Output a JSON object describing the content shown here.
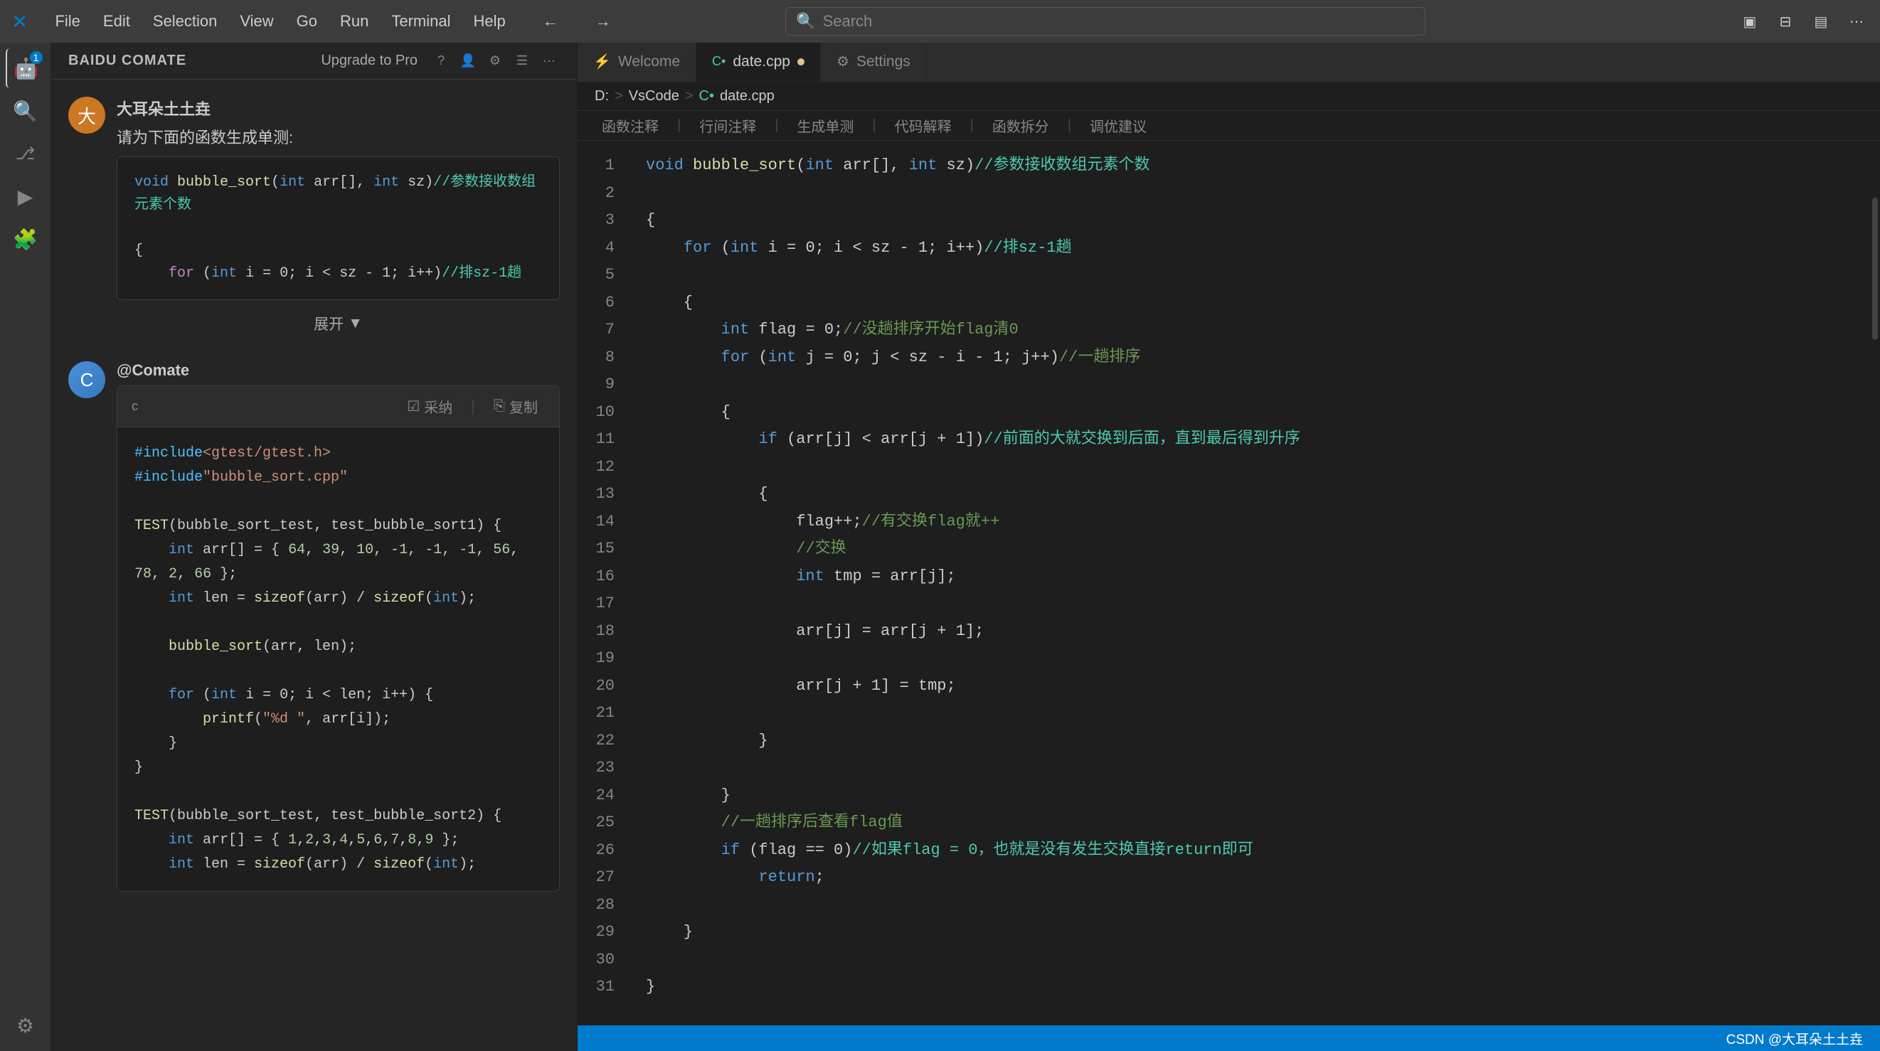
{
  "titlebar": {
    "menus": [
      "File",
      "Edit",
      "Selection",
      "View",
      "Go",
      "Run",
      "Terminal",
      "Help"
    ],
    "search_placeholder": "Search",
    "nav_back": "←",
    "nav_forward": "→"
  },
  "activity_bar": {
    "items": [
      {
        "icon": "🤖",
        "label": "comate-icon",
        "badge": "1",
        "active": true
      },
      {
        "icon": "🔍",
        "label": "search-icon"
      },
      {
        "icon": "⎇",
        "label": "source-control-icon"
      },
      {
        "icon": "▶",
        "label": "run-icon"
      },
      {
        "icon": "🧩",
        "label": "extensions-icon"
      }
    ],
    "bottom_items": [
      {
        "icon": "⚙",
        "label": "settings-icon"
      }
    ]
  },
  "sidebar": {
    "title": "BAIDU COMATE",
    "upgrade_label": "Upgrade to Pro",
    "actions": [
      "?",
      "👤",
      "⚙",
      "☰",
      "···"
    ]
  },
  "chat": {
    "user": {
      "name": "大耳朵土土垚",
      "avatar_text": "大",
      "prompt": "请为下面的函数生成单测:"
    },
    "code_preview": {
      "line1": "void bubble_sort(int arr[], int sz)//参数接收数组元素个数",
      "line2": "{",
      "line3": "    for (int i = 0; i < sz - 1; i++)//排sz-1趟",
      "expand_label": "展开",
      "expand_icon": "▼"
    },
    "comate": {
      "name": "@Comate",
      "avatar_text": "C",
      "lang": "c",
      "adopt_label": "采纳",
      "copy_label": "复制",
      "code_lines": [
        "#include<gtest/gtest.h>",
        "#include\"bubble_sort.cpp\"",
        "",
        "TEST(bubble_sort_test, test_bubble_sort1) {",
        "    int arr[] = { 64, 39, 10, -1, -1, -1, 56, 78, 2, 66 };",
        "    int len = sizeof(arr) / sizeof(int);",
        "",
        "    bubble_sort(arr, len);",
        "",
        "    for (int i = 0; i < len; i++) {",
        "        printf(\"%d \", arr[i]);",
        "    }",
        "}",
        "",
        "TEST(bubble_sort_test, test_bubble_sort2) {",
        "    int arr[] = { 1,2,3,4,5,6,7,8,9 };",
        "    int len = sizeof(arr) / sizeof(int);"
      ]
    }
  },
  "tabs": [
    {
      "label": "Welcome",
      "icon": "⚡",
      "active": false
    },
    {
      "label": "date.cpp",
      "icon": "C•",
      "active": true,
      "modified": true
    },
    {
      "label": "Settings",
      "icon": "⚙",
      "active": false
    }
  ],
  "breadcrumb": {
    "parts": [
      "D:",
      "VsCode",
      "C•",
      "date.cpp"
    ]
  },
  "toolbar": {
    "items": [
      "函数注释",
      "|",
      "行间注释",
      "|",
      "生成单测",
      "|",
      "代码解释",
      "|",
      "函数拆分",
      "|",
      "调优建议"
    ]
  },
  "editor": {
    "lines": [
      {
        "num": 1,
        "text": "void bubble_sort(int arr[], int sz)//参数接收数组元素个数"
      },
      {
        "num": 2,
        "text": ""
      },
      {
        "num": 3,
        "text": "{"
      },
      {
        "num": 4,
        "text": "    for (int i = 0; i < sz - 1; i++)//排sz-1趟"
      },
      {
        "num": 5,
        "text": ""
      },
      {
        "num": 6,
        "text": "    {"
      },
      {
        "num": 7,
        "text": "        int flag = 0;//没趟排序开始flag清0"
      },
      {
        "num": 8,
        "text": "        for (int j = 0; j < sz - i - 1; j++)//一趟排序"
      },
      {
        "num": 9,
        "text": ""
      },
      {
        "num": 10,
        "text": "        {"
      },
      {
        "num": 11,
        "text": "            if (arr[j] < arr[j + 1])//前面的大就交换到后面，直到最后得到升序"
      },
      {
        "num": 12,
        "text": ""
      },
      {
        "num": 13,
        "text": "            {"
      },
      {
        "num": 14,
        "text": "                flag++;//有交换flag就++"
      },
      {
        "num": 15,
        "text": "                //交换"
      },
      {
        "num": 16,
        "text": "                int tmp = arr[j];"
      },
      {
        "num": 17,
        "text": ""
      },
      {
        "num": 18,
        "text": "                arr[j] = arr[j + 1];"
      },
      {
        "num": 19,
        "text": ""
      },
      {
        "num": 20,
        "text": "                arr[j + 1] = tmp;"
      },
      {
        "num": 21,
        "text": ""
      },
      {
        "num": 22,
        "text": "            }"
      },
      {
        "num": 23,
        "text": ""
      },
      {
        "num": 24,
        "text": "        }"
      },
      {
        "num": 25,
        "text": "        //一趟排序后查看flag值"
      },
      {
        "num": 26,
        "text": "        if (flag == 0)//如果flag = 0，也就是没有发生交换直接return即可"
      },
      {
        "num": 27,
        "text": "            return;"
      },
      {
        "num": 28,
        "text": ""
      },
      {
        "num": 29,
        "text": "    }"
      },
      {
        "num": 30,
        "text": ""
      },
      {
        "num": 31,
        "text": "}"
      }
    ]
  },
  "statusbar": {
    "left": "CSDN @大耳朵土土垚"
  }
}
